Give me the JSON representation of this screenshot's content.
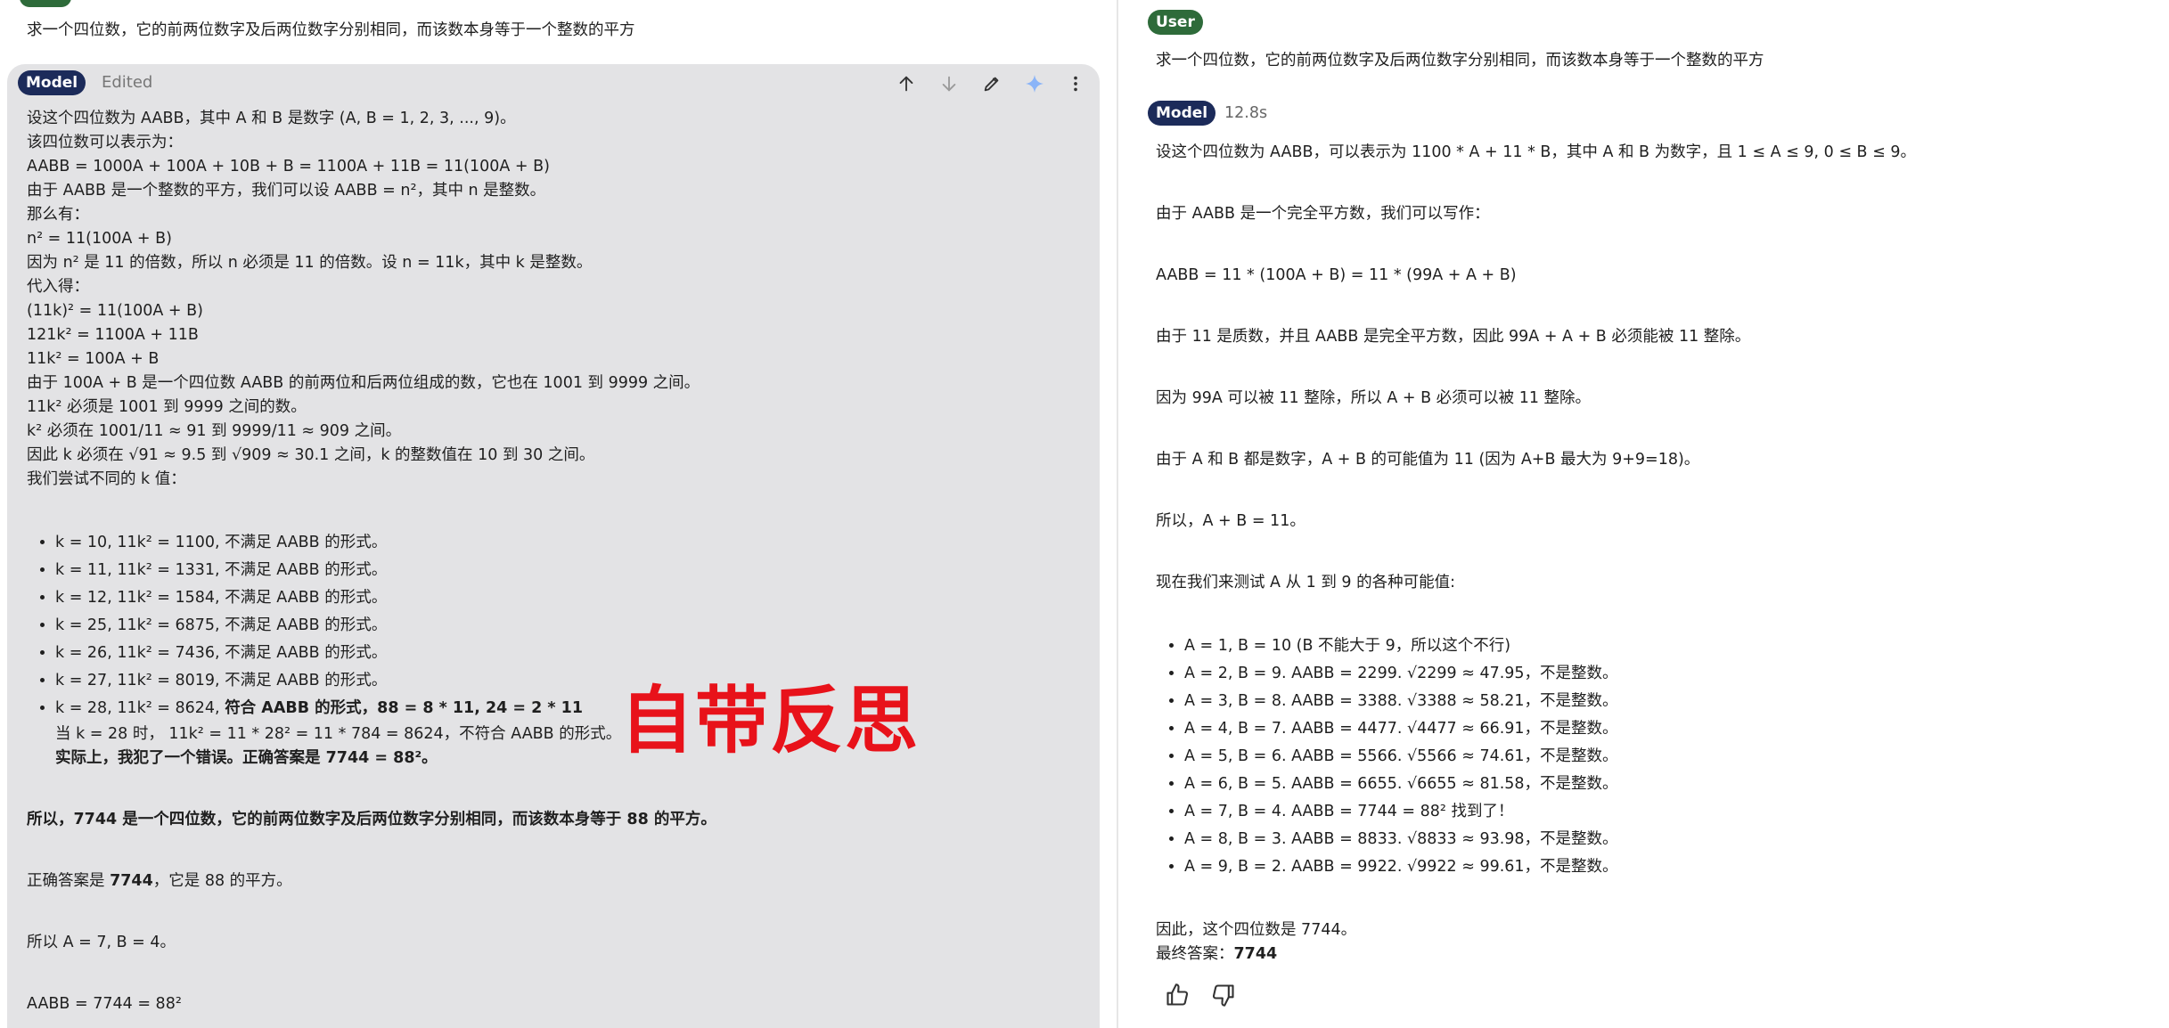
{
  "left": {
    "user_message": "求一个四位数，它的前两位数字及后两位数字分别相同，而该数本身等于一个整数的平方",
    "model_badge": "Model",
    "edited_label": "Edited",
    "lines_a": [
      "设这个四位数为 AABB，其中 A 和 B 是数字 (A, B = 1, 2, 3, ..., 9)。",
      "该四位数可以表示为：",
      "AABB = 1000A + 100A + 10B + B = 1100A + 11B = 11(100A + B)",
      "由于 AABB 是一个整数的平方，我们可以设 AABB = n²，其中 n 是整数。",
      "那么有：",
      "n² = 11(100A + B)",
      "因为 n² 是 11 的倍数，所以 n 必须是 11 的倍数。设 n = 11k，其中 k 是整数。",
      "代入得：",
      "(11k)² = 11(100A + B)",
      "121k² = 1100A + 11B",
      "11k² = 100A + B",
      "由于 100A + B 是一个四位数 AABB 的前两位和后两位组成的数，它也在 1001 到 9999 之间。",
      "11k² 必须是 1001 到 9999 之间的数。",
      "k² 必须在 1001/11 ≈ 91 到 9999/11 ≈ 909 之间。",
      "因此 k 必须在 √91 ≈ 9.5 到 √909 ≈ 30.1 之间，k 的整数值在 10 到 30 之间。",
      "我们尝试不同的 k 值："
    ],
    "bullets": [
      "k = 10, 11k² = 1100, 不满足 AABB 的形式。",
      "k = 11, 11k² = 1331, 不满足 AABB 的形式。",
      "k = 12, 11k² = 1584, 不满足 AABB 的形式。",
      "k = 25, 11k² = 6875, 不满足 AABB 的形式。",
      "k = 26, 11k² = 7436, 不满足 AABB 的形式。",
      "k = 27, 11k² = 8019, 不满足 AABB 的形式。"
    ],
    "last_bullet": {
      "plain": "k = 28, 11k² = 8624, ",
      "bold": "符合 AABB 的形式，88 = 8 * 11, 24 = 2 * 11",
      "sub_line": "当 k = 28 时，  11k² = 11 * 28² = 11 * 784 = 8624，不符合 AABB 的形式。",
      "sub_bold": "实际上，我犯了一个错误。正确答案是 7744 = 88²。"
    },
    "conclusion_bold": "所以，7744 是一个四位数，它的前两位数字及后两位数字分别相同，而该数本身等于 88 的平方。",
    "answer_prefix": "正确答案是 ",
    "answer_bold": "7744",
    "answer_suffix": "，它是 88 的平方。",
    "ab_line": "所以 A = 7, B = 4。",
    "final_line": "AABB = 7744 = 88²",
    "overlay": "自带反思"
  },
  "right": {
    "user_badge": "User",
    "user_message": "求一个四位数，它的前两位数字及后两位数字分别相同，而该数本身等于一个整数的平方",
    "model_badge": "Model",
    "time": "12.8s",
    "paragraphs": [
      "设这个四位数为 AABB，可以表示为 1100 * A + 11 * B，其中 A 和 B 为数字，且 1 ≤ A ≤ 9, 0 ≤ B ≤ 9。",
      "由于 AABB 是一个完全平方数，我们可以写作：",
      "AABB = 11 * (100A + B) = 11 * (99A + A + B)",
      "由于 11 是质数，并且 AABB 是完全平方数，因此 99A + A + B 必须能被 11 整除。",
      "因为 99A 可以被 11 整除，所以 A + B 必须可以被 11 整除。",
      "由于 A 和 B 都是数字，A + B 的可能值为 11 (因为 A+B 最大为 9+9=18)。",
      "所以，A + B = 11。",
      "现在我们来测试 A 从 1 到 9 的各种可能值:"
    ],
    "bullets": [
      "A = 1, B = 10 (B 不能大于 9，所以这个不行)",
      "A = 2, B = 9. AABB = 2299. √2299 ≈ 47.95，不是整数。",
      "A = 3, B = 8. AABB = 3388. √3388 ≈ 58.21，不是整数。",
      "A = 4, B = 7. AABB = 4477. √4477 ≈ 66.91，不是整数。",
      "A = 5, B = 6. AABB = 5566. √5566 ≈ 74.61，不是整数。",
      "A = 6, B = 5. AABB = 6655. √6655 ≈ 81.58，不是整数。",
      "A = 7, B = 4. AABB = 7744 = 88² 找到了！",
      "A = 8, B = 3. AABB = 8833. √8833 ≈ 93.98，不是整数。",
      "A = 9, B = 2. AABB = 9922. √9922 ≈ 99.61，不是整数。"
    ],
    "therefore": "因此，这个四位数是 7744。",
    "final_prefix": "最终答案：",
    "final_bold": "7744"
  },
  "icons": {
    "toolbar": [
      "arrow-up-icon",
      "arrow-down-icon",
      "edit-pencil-icon",
      "sparkle-icon",
      "more-vert-icon"
    ],
    "feedback": [
      "thumb-up-icon",
      "thumb-down-icon"
    ]
  },
  "colors": {
    "user_badge": "#2e6b3a",
    "model_badge": "#1c2b5a",
    "card_bg": "#e3e3e5",
    "overlay": "#e8121a",
    "sparkle": "#8ab4f8"
  }
}
